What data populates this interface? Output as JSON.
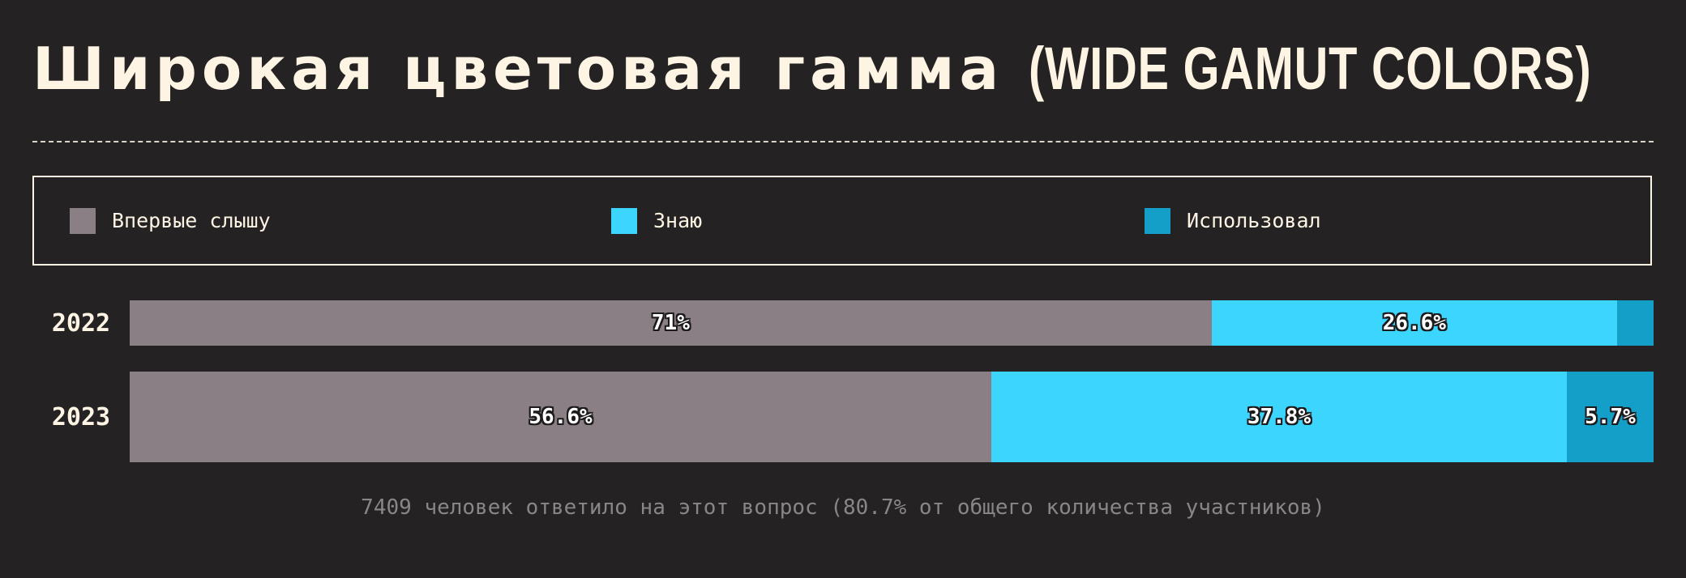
{
  "title": {
    "main": "Широкая цветовая гамма",
    "sub": "(WIDE GAMUT COLORS)"
  },
  "chart_data": {
    "type": "bar",
    "orientation": "horizontal",
    "stacked": true,
    "title": "Широкая цветовая гамма (WIDE GAMUT COLORS)",
    "categories": [
      "2022",
      "2023"
    ],
    "series": [
      {
        "name": "Впервые слышу",
        "color": "#8a7f84",
        "values": [
          71,
          56.6
        ],
        "labels": [
          "71%",
          "56.6%"
        ]
      },
      {
        "name": "Знаю",
        "color": "#3bd5fd",
        "values": [
          26.6,
          37.8
        ],
        "labels": [
          "26.6%",
          "37.8%"
        ]
      },
      {
        "name": "Использовал",
        "color": "#139fc8",
        "values": [
          2.4,
          5.7
        ],
        "labels": [
          "",
          "5.7%"
        ]
      }
    ],
    "xlim": [
      0,
      100
    ],
    "grid": false,
    "legend": "top"
  },
  "footnote": "7409 человек ответило на этот вопрос (80.7% от общего количества участников)"
}
